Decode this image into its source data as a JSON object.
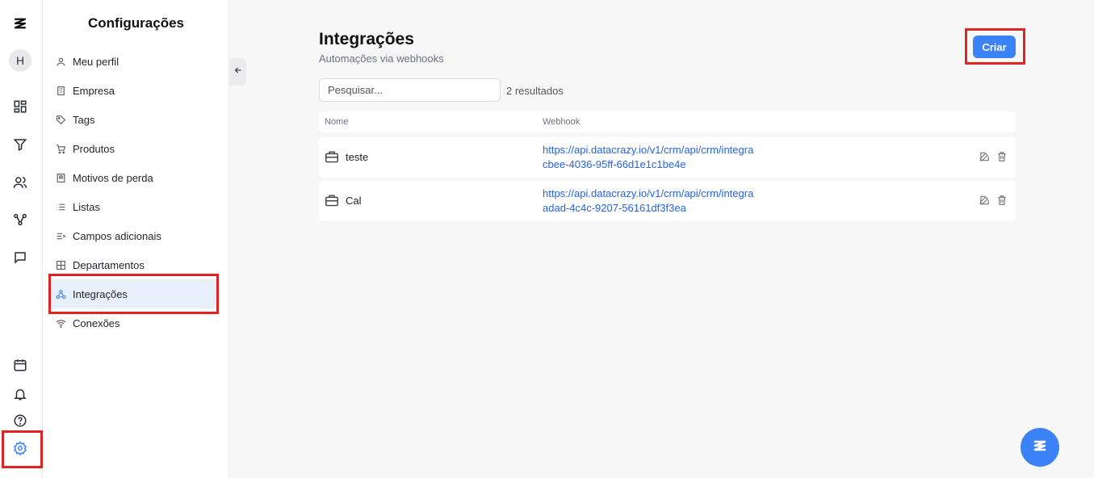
{
  "rail": {
    "avatar_initial": "H",
    "icons": [
      "logo-icon",
      "dashboard-icon",
      "filter-icon",
      "users-icon",
      "network-icon",
      "chat-icon",
      "calendar-icon",
      "bell-icon",
      "help-icon",
      "settings-icon"
    ]
  },
  "settings": {
    "title": "Configurações",
    "items": [
      {
        "label": "Meu perfil",
        "icon": "user-icon"
      },
      {
        "label": "Empresa",
        "icon": "building-icon"
      },
      {
        "label": "Tags",
        "icon": "tag-icon"
      },
      {
        "label": "Produtos",
        "icon": "cart-icon"
      },
      {
        "label": "Motivos de perda",
        "icon": "bookmark-icon"
      },
      {
        "label": "Listas",
        "icon": "list-icon"
      },
      {
        "label": "Campos adicionais",
        "icon": "fields-icon"
      },
      {
        "label": "Departamentos",
        "icon": "grid-icon"
      },
      {
        "label": "Integrações",
        "icon": "webhook-icon",
        "active": true
      },
      {
        "label": "Conexões",
        "icon": "wifi-icon"
      }
    ]
  },
  "main": {
    "title": "Integrações",
    "subtitle": "Automações via webhooks",
    "create_label": "Criar",
    "search_placeholder": "Pesquisar...",
    "results_text": "2 resultados",
    "columns": [
      "Nome",
      "Webhook"
    ],
    "rows": [
      {
        "name": "teste",
        "webhook_line1": "https://api.datacrazy.io/v1/crm/api/crm/integra",
        "webhook_line2": "cbee-4036-95ff-66d1e1c1be4e"
      },
      {
        "name": "Cal",
        "webhook_line1": "https://api.datacrazy.io/v1/crm/api/crm/integra",
        "webhook_line2": "adad-4c4c-9207-56161df3f3ea"
      }
    ]
  },
  "colors": {
    "accent": "#3b82f6",
    "link": "#2563eb",
    "highlight": "#e02424"
  }
}
